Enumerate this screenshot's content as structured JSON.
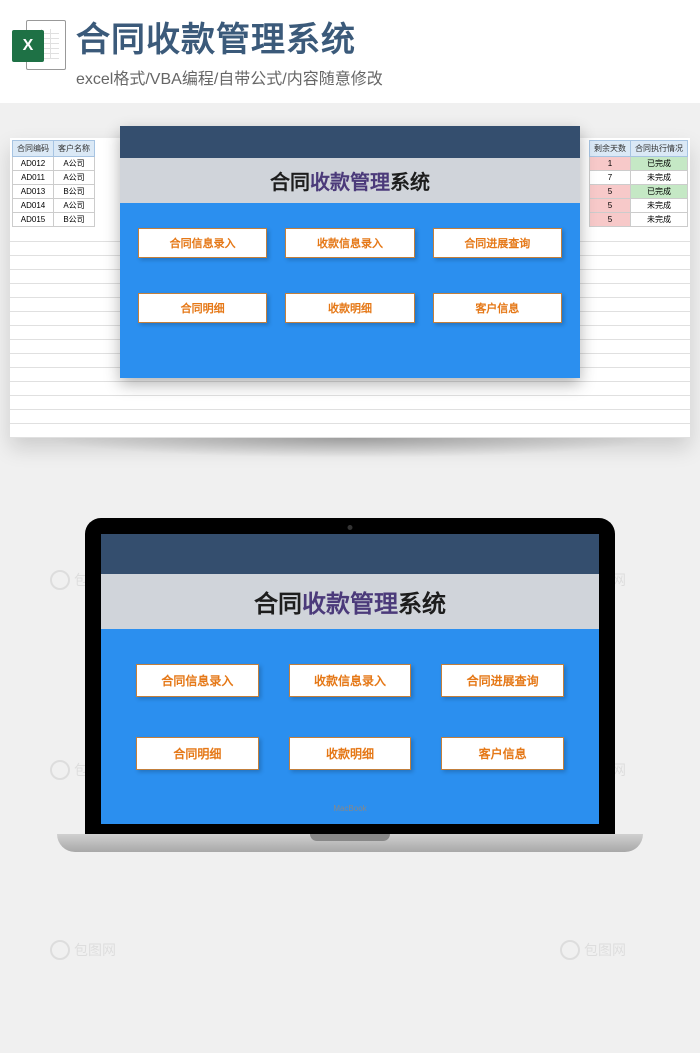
{
  "header": {
    "icon_letter": "X",
    "title": "合同收款管理系统",
    "subtitle": "excel格式/VBA编程/自带公式/内容随意修改"
  },
  "panel": {
    "title_part1": "合同",
    "title_accent": "收款管理",
    "title_part2": "系统",
    "buttons": [
      "合同信息录入",
      "收款信息录入",
      "合同进展查询",
      "合同明细",
      "收款明细",
      "客户信息"
    ]
  },
  "table_left": {
    "headers": [
      "合同编码",
      "客户名称"
    ],
    "rows": [
      [
        "AD012",
        "A公司"
      ],
      [
        "AD011",
        "A公司"
      ],
      [
        "AD013",
        "B公司"
      ],
      [
        "AD014",
        "A公司"
      ],
      [
        "AD015",
        "B公司"
      ]
    ]
  },
  "table_right": {
    "headers": [
      "剩余天数",
      "合同执行情况"
    ],
    "rows": [
      {
        "days": "1",
        "status": "已完成",
        "dcls": "cell-pink",
        "scls": "cell-green"
      },
      {
        "days": "7",
        "status": "未完成",
        "dcls": "",
        "scls": ""
      },
      {
        "days": "5",
        "status": "已完成",
        "dcls": "cell-pink",
        "scls": "cell-green"
      },
      {
        "days": "5",
        "status": "未完成",
        "dcls": "cell-pink",
        "scls": ""
      },
      {
        "days": "5",
        "status": "未完成",
        "dcls": "cell-pink",
        "scls": ""
      }
    ]
  },
  "laptop_label": "MacBook",
  "watermark_text": "包图网"
}
